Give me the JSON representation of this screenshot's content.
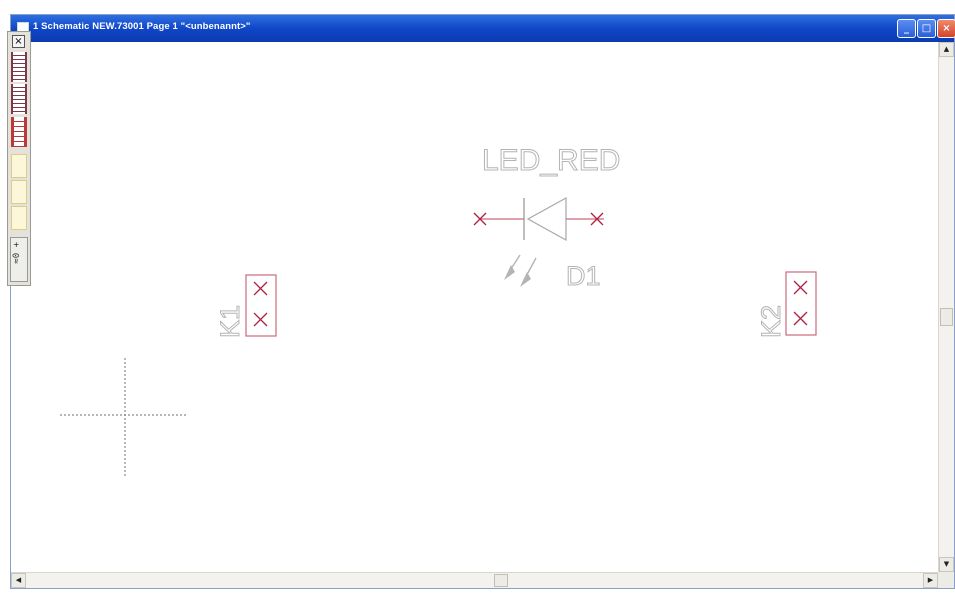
{
  "window": {
    "title": "1 Schematic NEW.73001 Page 1 \"<unbenannt>\"",
    "buttons": {
      "minimize": "_",
      "maximize": "□",
      "close": "×"
    }
  },
  "toolbox": {
    "close_label": "×",
    "rotated_label": "≈0 +"
  },
  "schematic": {
    "led": {
      "value": "LED_RED",
      "ref": "D1"
    },
    "connector_left": {
      "ref": "K1"
    },
    "connector_right": {
      "ref": "K2"
    }
  },
  "scrollbars": {
    "up": "▲",
    "down": "▼",
    "left": "◀",
    "right": "▶"
  },
  "colors": {
    "title_bar": "#1047c8",
    "component_outline": "#c96a7a",
    "pin_marker": "#b02040",
    "label_gray": "#a8a8a8"
  }
}
